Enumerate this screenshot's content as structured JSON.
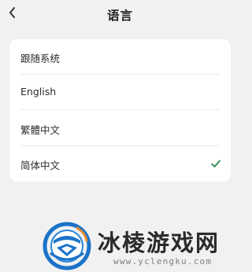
{
  "header": {
    "back_icon": "chevron-left-icon",
    "title": "语言"
  },
  "languages": [
    {
      "label": "跟随系统",
      "selected": false
    },
    {
      "label": "English",
      "selected": false
    },
    {
      "label": "繁體中文",
      "selected": false
    },
    {
      "label": "简体中文",
      "selected": true
    }
  ],
  "colors": {
    "background": "#f1f1f1",
    "card": "#ffffff",
    "check": "#2e8b57",
    "watermark_blue": "#1b73c8"
  },
  "watermark": {
    "text": "冰棱游戏网",
    "url": "www.yclengku.com"
  }
}
